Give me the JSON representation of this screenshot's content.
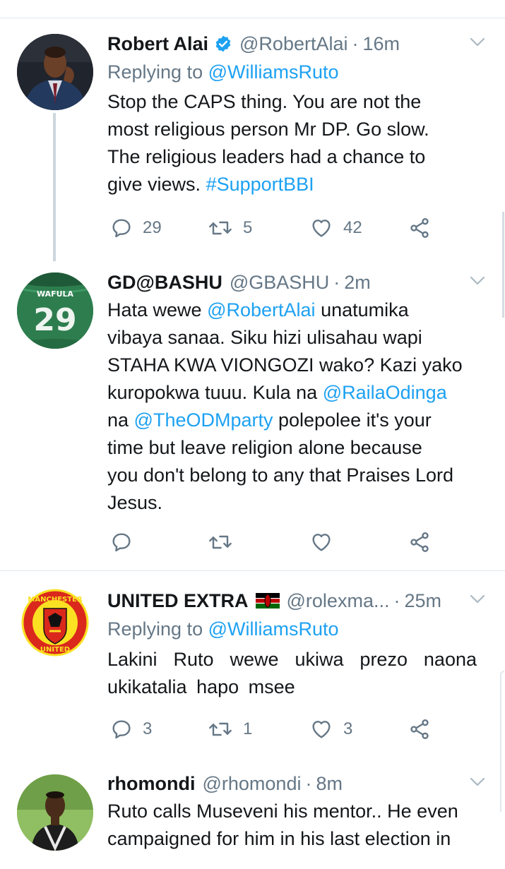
{
  "tweets": [
    {
      "name": "Robert Alai",
      "handle": "@RobertAlai",
      "dot": "·",
      "time": "16m",
      "replying_prefix": "Replying to",
      "replying_to": "@WilliamsRuto",
      "lines": [
        "Stop the CAPS thing. You are not the",
        "most religious person Mr DP. Go slow.",
        "The religious leaders had a chance to"
      ],
      "last_line_text": "give views. ",
      "hashtag": "#SupportBBI",
      "replies": "29",
      "retweets": "5",
      "likes": "42"
    },
    {
      "name": "GD@BASHU",
      "handle": "@GBASHU",
      "dot": "·",
      "time": "2m",
      "avatar_jersey_name": "WAFULA",
      "avatar_jersey_number": "29",
      "line1_a": "Hata wewe ",
      "line1_mention": "@RobertAlai",
      "line1_b": " unatumika",
      "line2": "vibaya sanaa. Siku hizi ulisahau wapi",
      "line3": "STAHA KWA VIONGOZI wako? Kazi yako",
      "line4_a": "kuropokwa tuuu. Kula na ",
      "line4_mention": "@RailaOdinga",
      "line5_a": "na ",
      "line5_mention": "@TheODMparty",
      "line5_b": " polepolee it's your",
      "line6": "time but leave religion alone because",
      "line7": "you don't belong to any that Praises Lord",
      "line8": "Jesus.",
      "replies": "",
      "retweets": "",
      "likes": ""
    },
    {
      "name": "UNITED EXTRA",
      "handle": "@rolexma...",
      "dot": "·",
      "time": "25m",
      "avatar_text_top": "MANCHESTER",
      "avatar_text_bottom": "UNITED",
      "replying_prefix": "Replying to",
      "replying_to": "@WilliamsRuto",
      "line1": "Lakini Ruto wewe ukiwa prezo naona",
      "line2": "ukikatalia hapo msee",
      "replies": "3",
      "retweets": "1",
      "likes": "3"
    },
    {
      "name": "rhomondi",
      "handle": "@rhomondi",
      "dot": "·",
      "time": "8m",
      "line1": "Ruto calls Museveni his mentor.. He even",
      "line2": "campaigned for him in his last election in"
    }
  ],
  "icons": {
    "reply": "reply-icon",
    "retweet": "retweet-icon",
    "like": "heart-icon",
    "share": "share-icon",
    "caret": "chevron-down-icon",
    "verified": "verified-badge-icon",
    "flag": "kenya-flag-icon"
  },
  "colors": {
    "link": "#1da1f2",
    "muted": "#657786",
    "text": "#14171a",
    "separator": "#e1e8ed",
    "verified": "#1da1f2"
  }
}
